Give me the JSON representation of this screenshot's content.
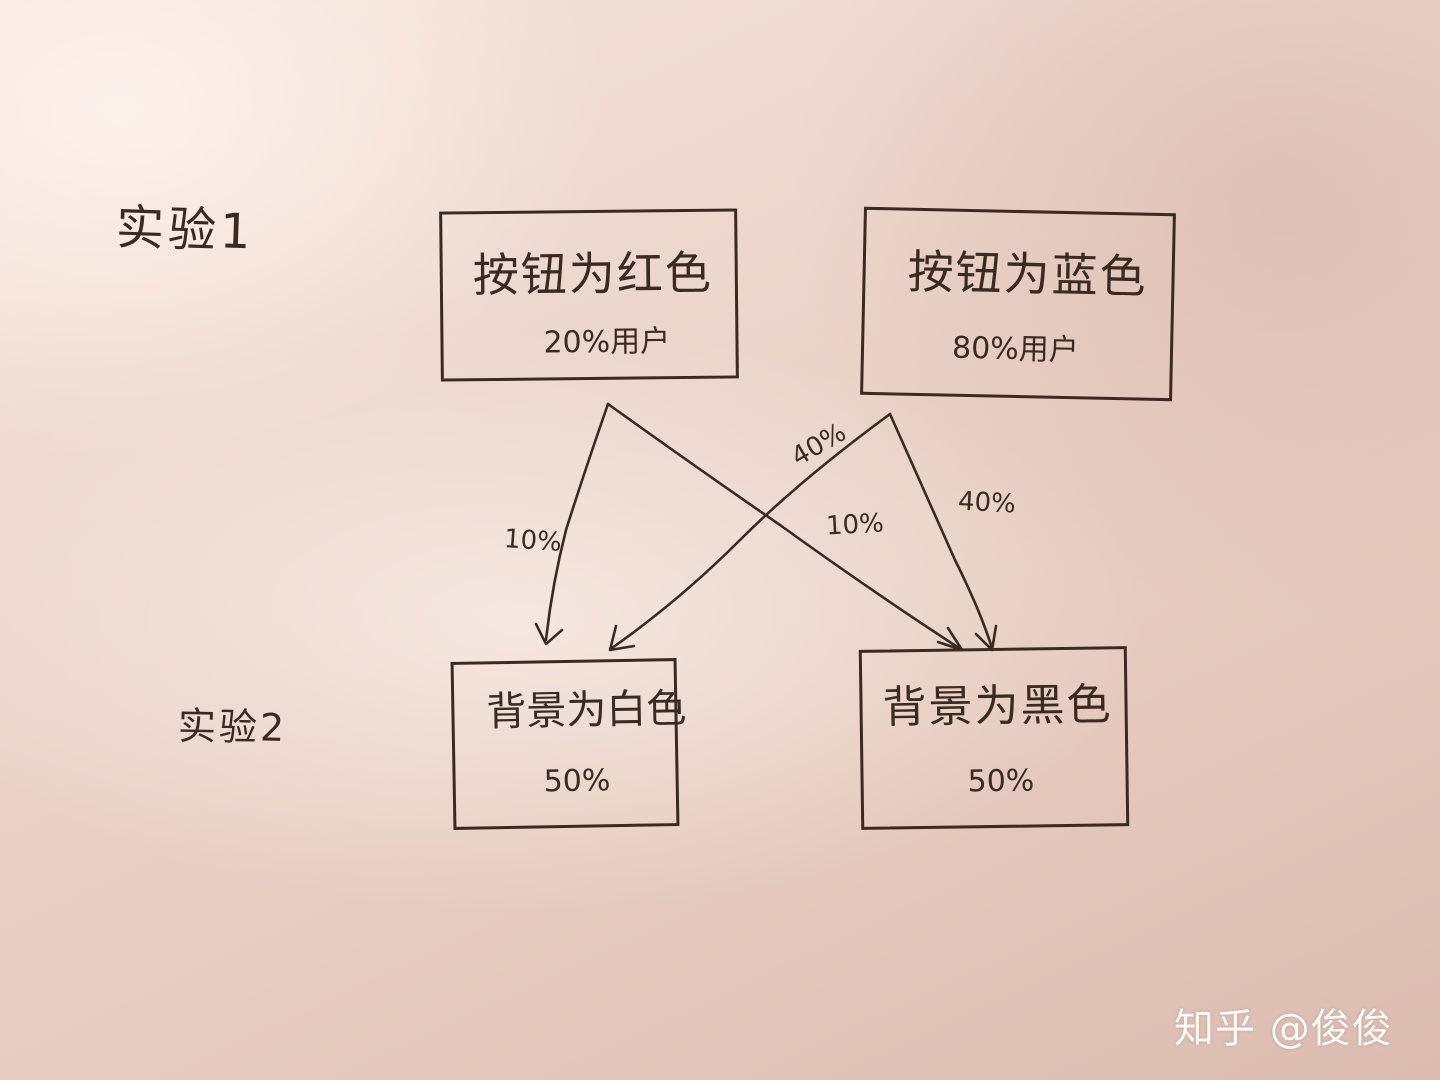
{
  "experiment_labels": {
    "exp1": "实验1",
    "exp2": "实验2"
  },
  "boxes": {
    "red_button": {
      "title": "按钮为红色",
      "share": "20%用户"
    },
    "blue_button": {
      "title": "按钮为蓝色",
      "share": "80%用户"
    },
    "white_background": {
      "title": "背景为白色",
      "share": "50%"
    },
    "black_background": {
      "title": "背景为黑色",
      "share": "50%"
    }
  },
  "flows": {
    "red_to_white": "10%",
    "red_to_black": "10%",
    "blue_to_white": "40%",
    "blue_to_black": "40%"
  },
  "watermark": "知乎 @俊俊",
  "colors": {
    "ink": "#3b2a21",
    "paper": "#ecd6cd"
  }
}
